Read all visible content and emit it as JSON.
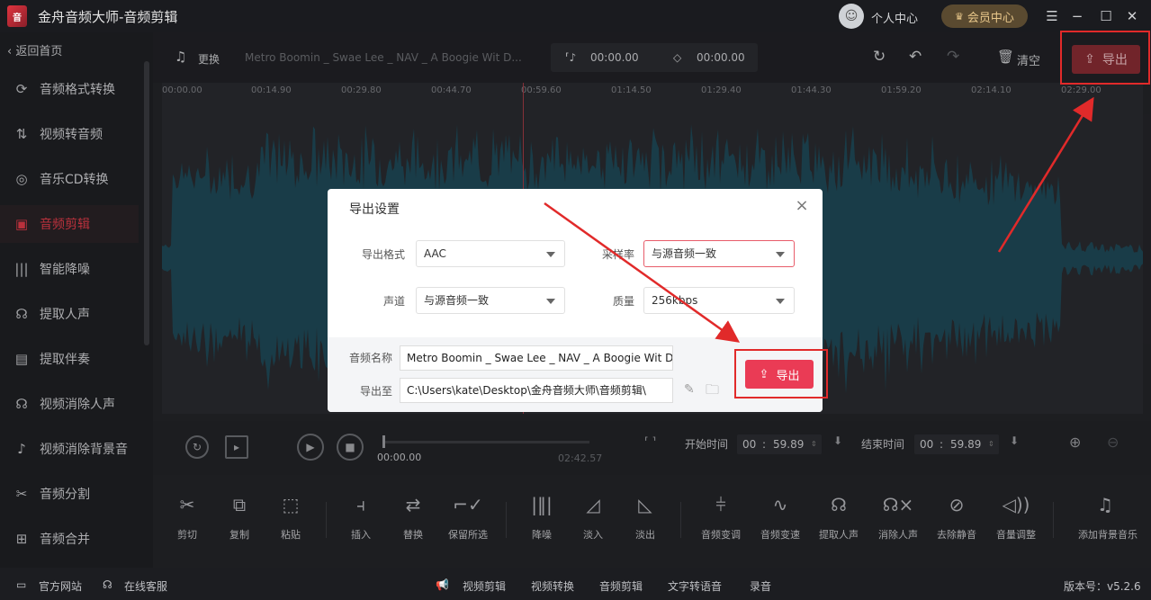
{
  "app": {
    "title": "金舟音频大师-音频剪辑",
    "logo_text": "音"
  },
  "header": {
    "user_center": "个人中心",
    "vip_center": "会员中心"
  },
  "sidebar": {
    "back": "返回首页",
    "items": [
      {
        "label": "音频格式转换",
        "icon": "audio-convert-icon"
      },
      {
        "label": "视频转音频",
        "icon": "video-to-audio-icon"
      },
      {
        "label": "音乐CD转换",
        "icon": "cd-icon"
      },
      {
        "label": "音频剪辑",
        "icon": "audio-cut-icon"
      },
      {
        "label": "智能降噪",
        "icon": "denoise-icon"
      },
      {
        "label": "提取人声",
        "icon": "voice-icon"
      },
      {
        "label": "提取伴奏",
        "icon": "accompany-icon"
      },
      {
        "label": "视频消除人声",
        "icon": "remove-voice-icon"
      },
      {
        "label": "视频消除背景音",
        "icon": "remove-bg-icon"
      },
      {
        "label": "音频分割",
        "icon": "split-icon"
      },
      {
        "label": "音频合并",
        "icon": "merge-icon"
      }
    ]
  },
  "toolbar": {
    "replace": "更换",
    "filename": "Metro Boomin _ Swae Lee _ NAV _ A Boogie Wit D...",
    "start_time": "00:00.00",
    "end_time": "00:00.00",
    "clear": "清空",
    "export": "导出"
  },
  "timeline": {
    "ticks": [
      "00:00.00",
      "00:14.90",
      "00:29.80",
      "00:44.70",
      "00:59.60",
      "01:14.50",
      "01:29.40",
      "01:44.30",
      "01:59.20",
      "02:14.10",
      "02:29.00"
    ]
  },
  "controls": {
    "current_time": "00:00.00",
    "total_time": "02:42.57",
    "start_label": "开始时间",
    "start_min": "00",
    "start_sec": "59.89",
    "end_label": "结束时间",
    "end_min": "00",
    "end_sec": "59.89"
  },
  "tools": [
    {
      "label": "剪切",
      "icon": "scissors-icon"
    },
    {
      "label": "复制",
      "icon": "copy-icon"
    },
    {
      "label": "粘贴",
      "icon": "paste-icon"
    },
    {
      "label": "插入",
      "icon": "insert-icon"
    },
    {
      "label": "替换",
      "icon": "replace-icon"
    },
    {
      "label": "保留所选",
      "icon": "keep-selection-icon"
    },
    {
      "label": "降噪",
      "icon": "noise-reduction-icon"
    },
    {
      "label": "淡入",
      "icon": "fade-in-icon"
    },
    {
      "label": "淡出",
      "icon": "fade-out-icon"
    },
    {
      "label": "音频变调",
      "icon": "pitch-icon"
    },
    {
      "label": "音频变速",
      "icon": "speed-icon"
    },
    {
      "label": "提取人声",
      "icon": "extract-voice-icon"
    },
    {
      "label": "消除人声",
      "icon": "remove-voice-tool-icon"
    },
    {
      "label": "去除静音",
      "icon": "mute-remove-icon"
    },
    {
      "label": "音量调整",
      "icon": "volume-icon"
    },
    {
      "label": "添加背景音乐",
      "icon": "music-note-icon"
    }
  ],
  "statusbar": {
    "website": "官方网站",
    "service": "在线客服",
    "links": [
      "视频剪辑",
      "视频转换",
      "音频剪辑",
      "文字转语音",
      "录音"
    ],
    "version": "版本号：v5.2.6"
  },
  "dialog": {
    "title": "导出设置",
    "format_label": "导出格式",
    "format_value": "AAC",
    "samplerate_label": "采样率",
    "samplerate_value": "与源音频一致",
    "channel_label": "声道",
    "channel_value": "与源音频一致",
    "quality_label": "质量",
    "quality_value": "256kbps",
    "name_label": "音频名称",
    "name_value": "Metro Boomin _ Swae Lee _ NAV _ A Boogie Wit D",
    "path_label": "导出至",
    "path_value": "C:\\Users\\kate\\Desktop\\金舟音频大师\\音频剪辑\\",
    "export": "导出"
  },
  "colors": {
    "accent": "#ea3b55",
    "wave": "#1f4a58",
    "annotation": "#e12a2a"
  }
}
